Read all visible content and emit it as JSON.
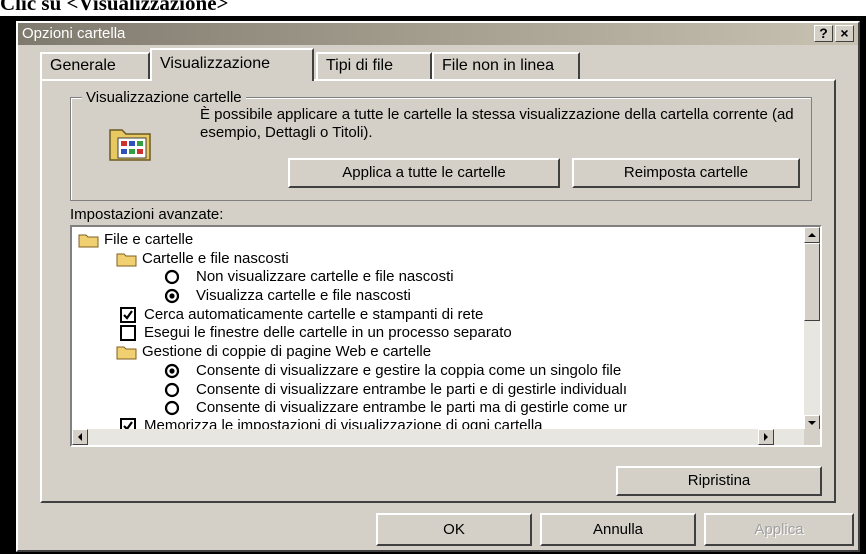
{
  "heading": "Clic su <Visualizzazione>",
  "window": {
    "title": "Opzioni cartella",
    "help_label": "?",
    "close_label": "×"
  },
  "tabs": [
    {
      "label": "Generale",
      "active": false
    },
    {
      "label": "Visualizzazione",
      "active": true
    },
    {
      "label": "Tipi di file",
      "active": false
    },
    {
      "label": "File non in linea",
      "active": false
    }
  ],
  "folder_view": {
    "legend": "Visualizzazione cartelle",
    "description": "È possibile applicare a tutte le cartelle la stessa visualizzazione della cartella corrente (ad esempio, Dettagli o Titoli).",
    "apply_all_label": "Applica a tutte le cartelle",
    "reset_label": "Reimposta cartelle",
    "icon": "folder-view-icon"
  },
  "advanced": {
    "label": "Impostazioni avanzate:",
    "items": [
      {
        "type": "folder",
        "label": "File e cartelle"
      },
      {
        "type": "folder",
        "label": "Cartelle e file nascosti"
      },
      {
        "type": "radio",
        "checked": false,
        "label": "Non visualizzare cartelle e file nascosti"
      },
      {
        "type": "radio",
        "checked": true,
        "label": "Visualizza cartelle e file nascosti"
      },
      {
        "type": "checkbox",
        "checked": true,
        "label": "Cerca automaticamente cartelle e stampanti di rete"
      },
      {
        "type": "checkbox",
        "checked": false,
        "label": "Esegui le finestre delle cartelle in un processo separato"
      },
      {
        "type": "folder",
        "label": "Gestione di coppie di pagine Web e cartelle"
      },
      {
        "type": "radio",
        "checked": true,
        "label": "Consente di visualizzare e gestire la coppia come un singolo file"
      },
      {
        "type": "radio",
        "checked": false,
        "label": "Consente di visualizzare entrambe le parti e di gestirle individualı"
      },
      {
        "type": "radio",
        "checked": false,
        "label": "Consente di visualizzare entrambe le parti ma di gestirle come ur"
      },
      {
        "type": "checkbox",
        "checked": true,
        "label": "Memorizza le impostazioni di visualizzazione di ogni cartella"
      }
    ],
    "restore_label": "Ripristina"
  },
  "footer": {
    "ok_label": "OK",
    "cancel_label": "Annulla",
    "apply_label": "Applica"
  }
}
